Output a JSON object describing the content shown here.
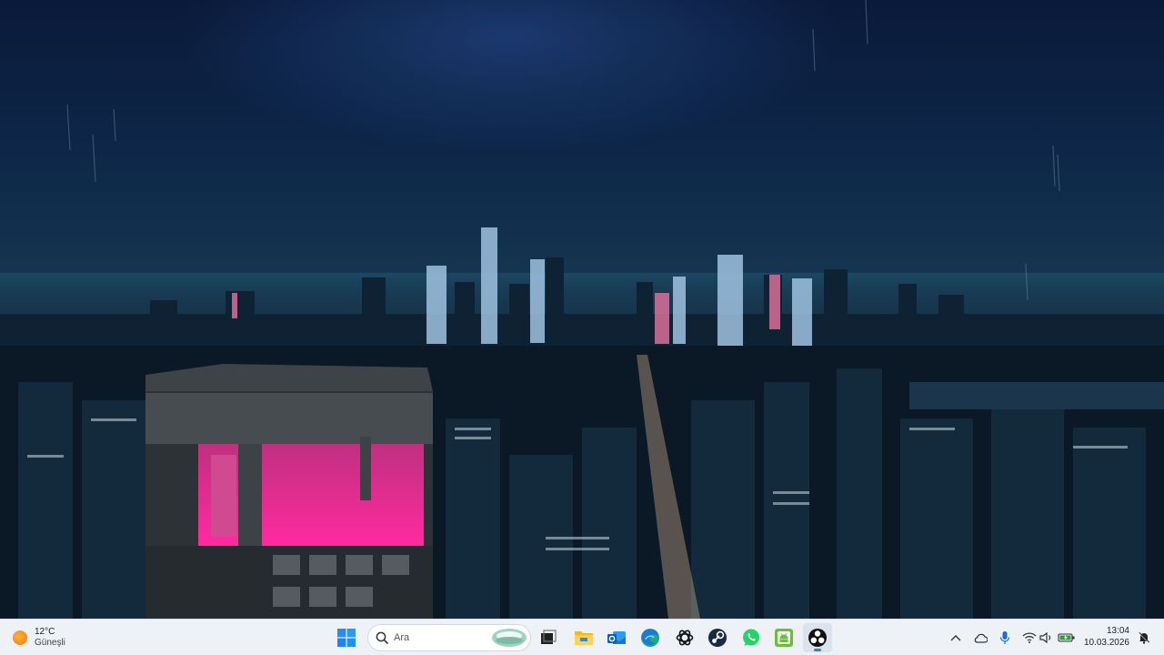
{
  "weather": {
    "temperature": "12°C",
    "condition": "Güneşli",
    "icon": "sun-icon"
  },
  "search": {
    "placeholder": "Ara"
  },
  "taskbar_apps": [
    {
      "name": "start-button",
      "icon": "windows-logo-icon"
    },
    {
      "name": "task-view-button",
      "icon": "task-view-icon"
    },
    {
      "name": "file-explorer-button",
      "icon": "folder-icon"
    },
    {
      "name": "outlook-button",
      "icon": "mail-icon"
    },
    {
      "name": "edge-button",
      "icon": "edge-browser-icon"
    },
    {
      "name": "chatgpt-button",
      "icon": "chatgpt-icon"
    },
    {
      "name": "steam-button",
      "icon": "steam-icon"
    },
    {
      "name": "whatsapp-button",
      "icon": "whatsapp-icon"
    },
    {
      "name": "android-app-button",
      "icon": "android-icon"
    },
    {
      "name": "obs-button",
      "icon": "obs-icon",
      "active": true
    }
  ],
  "tray": {
    "icons": [
      "chevron-up-icon",
      "cloud-icon",
      "microphone-icon",
      "wifi-icon",
      "speaker-icon",
      "battery-icon"
    ]
  },
  "clock": {
    "time": "13:04",
    "date": "10.03.2026"
  },
  "colors": {
    "accent_pink": "#ff2fa0",
    "taskbar_bg": "#eef1f6",
    "sky_top": "#0a1a3a"
  }
}
